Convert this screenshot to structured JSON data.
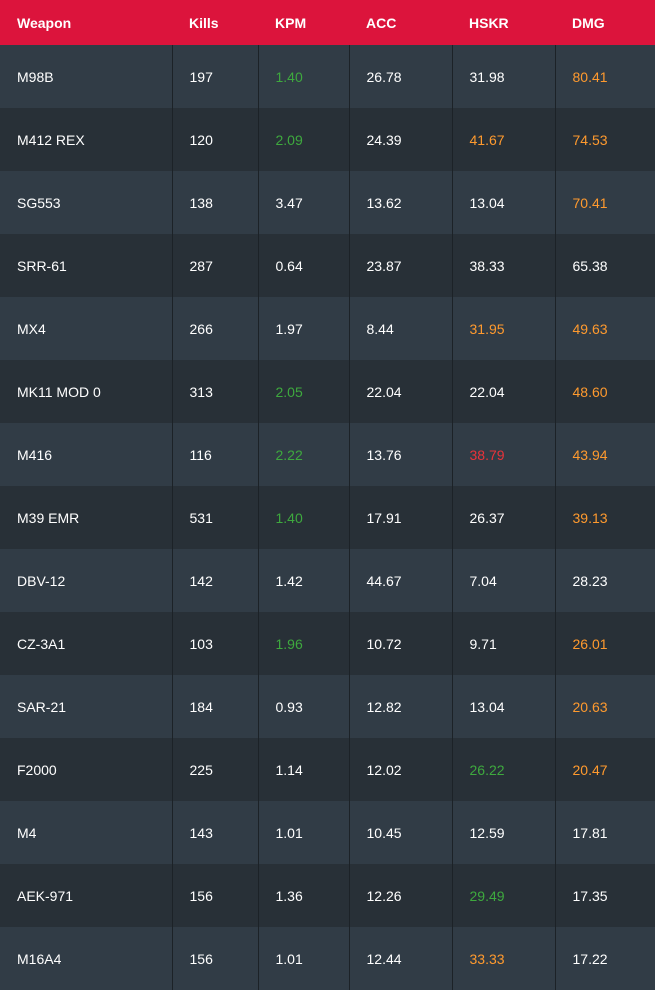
{
  "header": {
    "weapon": "Weapon",
    "kills": "Kills",
    "kpm": "KPM",
    "acc": "ACC",
    "hskr": "HSKR",
    "dmg": "DMG"
  },
  "colors": {
    "header_bg": "#dc143c",
    "row_odd": "#313c46",
    "row_even": "#283037",
    "good": "#3ea93e",
    "high": "#ff9a2e",
    "bad": "#e8333a"
  },
  "rows": [
    {
      "weapon": "M98B",
      "kills": "197",
      "kpm": "1.40",
      "kpm_c": "green",
      "acc": "26.78",
      "hskr": "31.98",
      "hskr_c": "white",
      "dmg": "80.41",
      "dmg_c": "orange"
    },
    {
      "weapon": "M412 REX",
      "kills": "120",
      "kpm": "2.09",
      "kpm_c": "green",
      "acc": "24.39",
      "hskr": "41.67",
      "hskr_c": "orange",
      "dmg": "74.53",
      "dmg_c": "orange"
    },
    {
      "weapon": "SG553",
      "kills": "138",
      "kpm": "3.47",
      "kpm_c": "white",
      "acc": "13.62",
      "hskr": "13.04",
      "hskr_c": "white",
      "dmg": "70.41",
      "dmg_c": "orange"
    },
    {
      "weapon": "SRR-61",
      "kills": "287",
      "kpm": "0.64",
      "kpm_c": "white",
      "acc": "23.87",
      "hskr": "38.33",
      "hskr_c": "white",
      "dmg": "65.38",
      "dmg_c": "white"
    },
    {
      "weapon": "MX4",
      "kills": "266",
      "kpm": "1.97",
      "kpm_c": "white",
      "acc": "8.44",
      "hskr": "31.95",
      "hskr_c": "orange",
      "dmg": "49.63",
      "dmg_c": "orange"
    },
    {
      "weapon": "MK11 MOD 0",
      "kills": "313",
      "kpm": "2.05",
      "kpm_c": "green",
      "acc": "22.04",
      "hskr": "22.04",
      "hskr_c": "white",
      "dmg": "48.60",
      "dmg_c": "orange"
    },
    {
      "weapon": "M416",
      "kills": "116",
      "kpm": "2.22",
      "kpm_c": "green",
      "acc": "13.76",
      "hskr": "38.79",
      "hskr_c": "red",
      "dmg": "43.94",
      "dmg_c": "orange"
    },
    {
      "weapon": "M39 EMR",
      "kills": "531",
      "kpm": "1.40",
      "kpm_c": "green",
      "acc": "17.91",
      "hskr": "26.37",
      "hskr_c": "white",
      "dmg": "39.13",
      "dmg_c": "orange"
    },
    {
      "weapon": "DBV-12",
      "kills": "142",
      "kpm": "1.42",
      "kpm_c": "white",
      "acc": "44.67",
      "hskr": "7.04",
      "hskr_c": "white",
      "dmg": "28.23",
      "dmg_c": "white"
    },
    {
      "weapon": "CZ-3A1",
      "kills": "103",
      "kpm": "1.96",
      "kpm_c": "green",
      "acc": "10.72",
      "hskr": "9.71",
      "hskr_c": "white",
      "dmg": "26.01",
      "dmg_c": "orange"
    },
    {
      "weapon": "SAR-21",
      "kills": "184",
      "kpm": "0.93",
      "kpm_c": "white",
      "acc": "12.82",
      "hskr": "13.04",
      "hskr_c": "white",
      "dmg": "20.63",
      "dmg_c": "orange"
    },
    {
      "weapon": "F2000",
      "kills": "225",
      "kpm": "1.14",
      "kpm_c": "white",
      "acc": "12.02",
      "hskr": "26.22",
      "hskr_c": "green",
      "dmg": "20.47",
      "dmg_c": "orange"
    },
    {
      "weapon": "M4",
      "kills": "143",
      "kpm": "1.01",
      "kpm_c": "white",
      "acc": "10.45",
      "hskr": "12.59",
      "hskr_c": "white",
      "dmg": "17.81",
      "dmg_c": "white"
    },
    {
      "weapon": "AEK-971",
      "kills": "156",
      "kpm": "1.36",
      "kpm_c": "white",
      "acc": "12.26",
      "hskr": "29.49",
      "hskr_c": "green",
      "dmg": "17.35",
      "dmg_c": "white"
    },
    {
      "weapon": "M16A4",
      "kills": "156",
      "kpm": "1.01",
      "kpm_c": "white",
      "acc": "12.44",
      "hskr": "33.33",
      "hskr_c": "orange",
      "dmg": "17.22",
      "dmg_c": "white"
    }
  ]
}
